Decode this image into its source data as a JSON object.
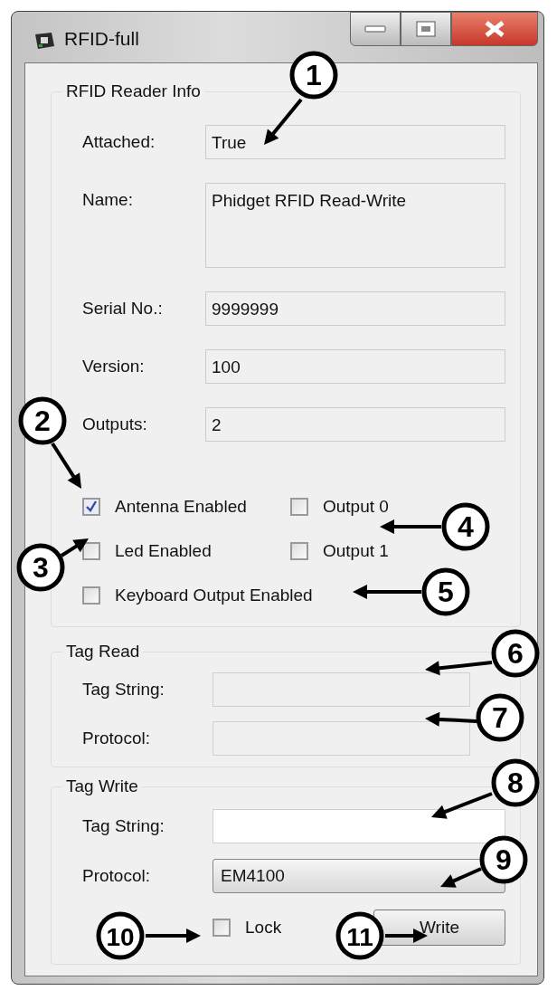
{
  "window": {
    "title": "RFID-full"
  },
  "reader_info": {
    "title": "RFID Reader Info",
    "fields": [
      {
        "label": "Attached:",
        "value": "True",
        "kind": "single"
      },
      {
        "label": "Name:",
        "value": "Phidget RFID Read-Write",
        "kind": "multi"
      },
      {
        "label": "Serial No.:",
        "value": "9999999",
        "kind": "single"
      },
      {
        "label": "Version:",
        "value": "100",
        "kind": "single"
      },
      {
        "label": "Outputs:",
        "value": "2",
        "kind": "single"
      }
    ],
    "checkboxes": [
      {
        "label": "Antenna Enabled",
        "checked": true
      },
      {
        "label": "Output 0",
        "checked": false
      },
      {
        "label": "Led Enabled",
        "checked": false
      },
      {
        "label": "Output 1",
        "checked": false
      },
      {
        "label": "Keyboard Output Enabled",
        "checked": false
      }
    ]
  },
  "tag_read": {
    "title": "Tag Read",
    "fields": [
      {
        "label": "Tag String:",
        "disabled": true
      },
      {
        "label": "Protocol:",
        "disabled": true
      }
    ]
  },
  "tag_write": {
    "title": "Tag Write",
    "fields": [
      {
        "label": "Tag String:",
        "kind": "text",
        "disabled": false
      },
      {
        "label": "Protocol:",
        "kind": "dropdown",
        "value": "EM4100",
        "disabled": false
      }
    ],
    "lock": {
      "label": "Lock",
      "checked": false
    },
    "write_button": "Write"
  },
  "callouts": [
    {
      "number": "1"
    },
    {
      "number": "2"
    },
    {
      "number": "3"
    },
    {
      "number": "4"
    },
    {
      "number": "5"
    },
    {
      "number": "6"
    },
    {
      "number": "7"
    },
    {
      "number": "8"
    },
    {
      "number": "9"
    },
    {
      "number": "10"
    },
    {
      "number": "11"
    }
  ]
}
